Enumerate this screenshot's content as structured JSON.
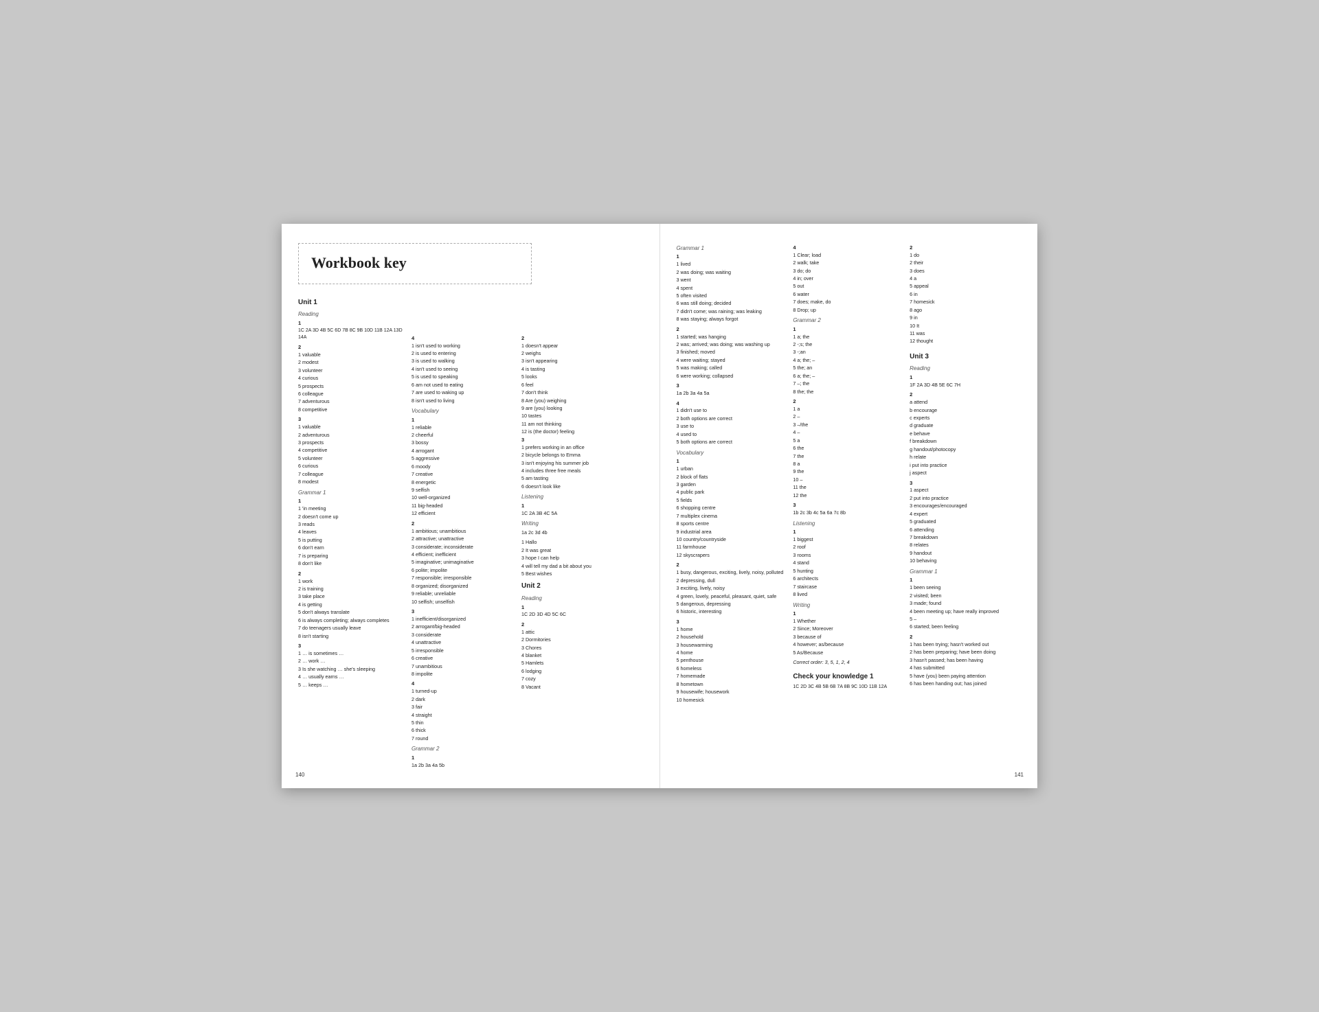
{
  "left_page": {
    "page_number": "140",
    "workbook_key": "Workbook key",
    "unit1": {
      "title": "Unit 1",
      "reading": {
        "label": "Reading",
        "q1": "1C  2A  3D  4B  5C  6D  7B  8C  9B\n10D  11B  12A  13D  14A",
        "q2_items": [
          "1  valuable",
          "2  modest",
          "3  volunteer",
          "4  curious",
          "5  prospects",
          "6  colleague",
          "7  adventurous",
          "8  competitive"
        ],
        "q3_items": [
          "1  valuable",
          "2  adventurous",
          "3  prospects",
          "4  competitive",
          "5  volunteer",
          "6  curious",
          "7  colleague",
          "8  modest"
        ]
      },
      "grammar1": {
        "label": "Grammar 1",
        "q1_items": [
          "1  'in meeting",
          "2  doesn't come up",
          "3  reads",
          "4  leaves",
          "5  is putting",
          "6  don't earn",
          "7  is preparing",
          "8  don't like"
        ],
        "q2_items": [
          "1  work",
          "2  is training",
          "3  take place",
          "4  is getting",
          "5  don't always translate",
          "6  is always completing; always completes",
          "7  do teenagers usually leave",
          "8  isn't starting"
        ],
        "q3_items": [
          "1  … is sometimes …",
          "2  … work …",
          "3  Is she watching … she's sleeping",
          "4  … usually earns …",
          "5  … keeps …"
        ]
      }
    },
    "left_col2": {
      "q4_header": "4",
      "q4_items": [
        "1  isn't used to working",
        "2  is used to entering",
        "3  is used to walking",
        "4  isn't used to seeing",
        "5  is used to speaking",
        "6  am not used to eating",
        "7  are used to waking up",
        "8  isn't used to living"
      ],
      "vocabulary": {
        "label": "Vocabulary",
        "q1_items": [
          "1  reliable",
          "2  cheerful",
          "3  bossy",
          "4  arrogant",
          "5  aggressive",
          "6  moody",
          "7  creative",
          "8  energetic",
          "9  selfish",
          "10  well-organized",
          "11  big-headed",
          "12  efficient"
        ],
        "q2_items": [
          "1  ambitious; unambitious",
          "2  attractive; unattractive",
          "3  considerate; inconsiderate",
          "4  efficient; inefficient",
          "5  imaginative; unimaginative",
          "6  polite; impolite",
          "7  responsible; irresponsible",
          "8  organized; disorganized",
          "9  reliable; unreliable",
          "10  selfish; unselfish"
        ],
        "q3_items": [
          "1  inefficient/disorganized",
          "2  arrogant/big-headed",
          "3  considerate",
          "4  unattractive",
          "5  irresponsible",
          "6  creative",
          "7  unambitious",
          "8  impolite"
        ],
        "q4_items": [
          "1  turned-up",
          "2  dark",
          "3  fair",
          "4  straight",
          "5  thin",
          "6  thick",
          "7  round"
        ],
        "grammar2": {
          "label": "Grammar 2",
          "q1": "1a  2b  3a  4a  5b"
        }
      }
    },
    "left_col3": {
      "q2_header": "2",
      "q2_items": [
        "1  doesn't appear",
        "2  weighs",
        "3  isn't appearing",
        "4  is tasting",
        "5  looks",
        "6  feel",
        "7  don't think",
        "8  Are (you) weighing",
        "9  are (you) looking",
        "10  tastes",
        "11  am not thinking",
        "12  is (the doctor) feeling"
      ],
      "q3_items": [
        "1  prefers working in an office",
        "2  bicycle belongs to Emma",
        "3  isn't enjoying his summer job",
        "4  includes three free meals",
        "5  am tasting",
        "6  doesn't look like"
      ],
      "listening": {
        "label": "Listening",
        "q1": "1C  2A  3B  4C  5A"
      },
      "writing": {
        "label": "Writing",
        "q1_items": [
          "1a  2c  3d  4b"
        ],
        "q2_items": [
          "1  Hallo",
          "2  It was great",
          "3  hope I can help",
          "4  will tell my dad a bit about you",
          "5  Best wishes"
        ]
      },
      "unit2": {
        "title": "Unit 2",
        "reading": {
          "label": "Reading",
          "q1": "1C  2D  3D  4D  5C  6C",
          "q2_items": [
            "1  attic",
            "2  Dormitories",
            "3  Chores",
            "4  blanket",
            "5  Hamlets",
            "6  lodging",
            "7  cozy",
            "8  Vacant"
          ]
        }
      }
    }
  },
  "right_page": {
    "page_number": "141",
    "col1": {
      "grammar1": {
        "label": "Grammar 1",
        "q1_items": [
          "1  lived",
          "2  was doing; was waiting",
          "3  went",
          "4  spent",
          "5  often visited",
          "6  was still doing; decided",
          "7  didn't come; was raining; was leaking",
          "8  was staying; always forgot"
        ],
        "q2_items": [
          "1  started; was hanging",
          "2  was; arrived; was doing; was washing up",
          "3  finished; moved",
          "4  were waiting; stayed",
          "5  was making; called",
          "6  were working; collapsed"
        ],
        "q3": "1a  2b  3a  4a  5a",
        "q4_items": [
          "1  didn't use to",
          "2  both options are correct",
          "3  use to",
          "4  used to",
          "5  both options are correct"
        ]
      },
      "vocabulary": {
        "label": "Vocabulary",
        "q1_items": [
          "1  urban",
          "2  block of flats",
          "3  garden",
          "4  public park",
          "5  fields",
          "6  shopping centre",
          "7  multiplex cinema",
          "8  sports centre",
          "9  industrial area",
          "10  country/countryside",
          "11  farmhouse",
          "12  skyscrapers"
        ],
        "q2_items": [
          "1  busy, dangerous, exciting, lively, noisy, polluted",
          "2  depressing, dull",
          "3  exciting, lively, noisy",
          "4  green, lovely, peaceful, pleasant, quiet, safe",
          "5  dangerous, depressing",
          "6  historic, interesting"
        ],
        "q3_items": [
          "1  home",
          "2  household",
          "3  housewarming",
          "4  home",
          "5  penthouse",
          "6  homeless",
          "7  homemade",
          "8  hometown",
          "9  housewife; housework",
          "10  homesick"
        ]
      }
    },
    "col2": {
      "q4_items": [
        "1  Clear; load",
        "2  walk; take",
        "3  do; do",
        "4  in; over",
        "5  out",
        "6  water",
        "7  does; make, do",
        "8  Drop; up"
      ],
      "grammar2": {
        "label": "Grammar 2",
        "q1_items": [
          "1  a; the",
          "2  -;s; the",
          "3  -;an",
          "4  a; the; –",
          "5  the; an",
          "6  a; the; –",
          "7  –; the",
          "8  the; the"
        ],
        "q2_items": [
          "1  a",
          "2  –",
          "3  –/the",
          "4  –",
          "5  a",
          "6  the",
          "7  the",
          "8  a",
          "9  the",
          "10  –",
          "11  the",
          "12  the"
        ],
        "q3": "1b  2c  3b  4c  5a  6a  7c  8b"
      },
      "listening": {
        "label": "Listening",
        "q1_items": [
          "1  biggest",
          "2  roof",
          "3  rooms",
          "4  stand",
          "5  hunting",
          "6  architects",
          "7  staircase",
          "8  lived"
        ]
      },
      "writing": {
        "label": "Writing",
        "q1_items": [
          "1  Whether",
          "2  Since; Moreover",
          "3  because of",
          "4  however; as/because",
          "5  As/Because"
        ],
        "correct_order": "Correct order: 3, 5, 1, 2, 4"
      },
      "check": {
        "label": "Check your knowledge 1",
        "answer": "1C  2D  3C  4B  5B  6B  7A  8B  9C\n10D  11B  12A"
      }
    },
    "col3": {
      "q2_header": "2",
      "q2_items": [
        "1  do",
        "2  their",
        "3  does",
        "4  a",
        "5  appeal",
        "6  in",
        "7  homesick",
        "8  ago",
        "9  in",
        "10  It",
        "11  was",
        "12  thought"
      ],
      "unit3": {
        "title": "Unit 3",
        "reading": {
          "label": "Reading",
          "q1": "1F  2A  3D  4B  5E  6C  7H",
          "q2_items": [
            "a  attend",
            "b  encourage",
            "c  experts",
            "d  graduate",
            "e  behave",
            "f  breakdown",
            "g  handout/photocopy",
            "h  relate",
            "i  put into practice",
            "j  aspect"
          ],
          "q3_items": [
            "1  aspect",
            "2  put into practice",
            "3  encourages/encouraged",
            "4  expert",
            "5  graduated",
            "6  attending",
            "7  breakdown",
            "8  relates",
            "9  handout",
            "10  behaving"
          ]
        },
        "grammar1": {
          "label": "Grammar 1",
          "q1_items": [
            "1  been seeing",
            "2  visited; been",
            "3  made; found",
            "4  been meeting up; have really improved",
            "5  –",
            "6  started; been feeling"
          ],
          "q2_items": [
            "1  has been trying; hasn't worked out",
            "2  has been preparing; have been doing",
            "3  hasn't passed; has been having",
            "4  has submitted",
            "5  have (you) been paying attention",
            "6  has been handing out; has joined"
          ]
        }
      }
    }
  }
}
